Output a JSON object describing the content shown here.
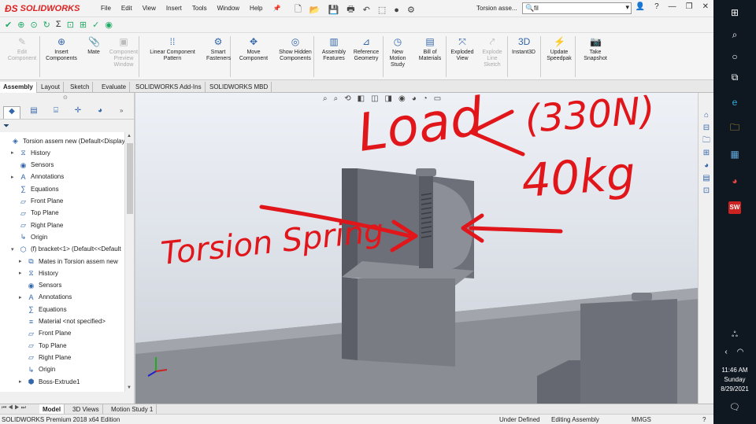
{
  "app": {
    "brand": "SOLIDWORKS",
    "doc_title": "Torsion asse...",
    "search_value": "fil"
  },
  "menu": [
    "File",
    "Edit",
    "View",
    "Insert",
    "Tools",
    "Window",
    "Help"
  ],
  "commands": [
    {
      "label": "Edit Component",
      "disabled": true,
      "icon": "edit-component-icon"
    },
    {
      "label": "Insert Components",
      "disabled": false,
      "icon": "insert-components-icon"
    },
    {
      "label": "Mate",
      "disabled": false,
      "icon": "paperclip-icon"
    },
    {
      "label": "Component Preview Window",
      "disabled": true,
      "icon": "preview-window-icon"
    },
    {
      "label": "Linear Component Pattern",
      "disabled": false,
      "icon": "pattern-icon"
    },
    {
      "label": "Smart Fasteners",
      "disabled": false,
      "icon": "fastener-icon"
    },
    {
      "label": "Move Component",
      "disabled": false,
      "icon": "move-icon"
    },
    {
      "label": "Show Hidden Components",
      "disabled": false,
      "icon": "show-hidden-icon"
    },
    {
      "label": "Assembly Features",
      "disabled": false,
      "icon": "assembly-features-icon"
    },
    {
      "label": "Reference Geometry",
      "disabled": false,
      "icon": "reference-geometry-icon"
    },
    {
      "label": "New Motion Study",
      "disabled": false,
      "icon": "motion-study-icon"
    },
    {
      "label": "Bill of Materials",
      "disabled": false,
      "icon": "bom-icon"
    },
    {
      "label": "Exploded View",
      "disabled": false,
      "icon": "exploded-view-icon"
    },
    {
      "label": "Explode Line Sketch",
      "disabled": true,
      "icon": "explode-line-icon"
    },
    {
      "label": "Instant3D",
      "disabled": false,
      "icon": "instant3d-icon"
    },
    {
      "label": "Update Speedpak",
      "disabled": false,
      "icon": "speedpak-icon"
    },
    {
      "label": "Take Snapshot",
      "disabled": false,
      "icon": "camera-icon"
    }
  ],
  "tabs": [
    "Assembly",
    "Layout",
    "Sketch",
    "Evaluate",
    "SOLIDWORKS Add-Ins",
    "SOLIDWORKS MBD"
  ],
  "tree": [
    {
      "label": "Torsion assem new  (Default<Display",
      "level": 0,
      "expander": "",
      "icon": "assembly-icon"
    },
    {
      "label": "History",
      "level": 1,
      "expander": "▸",
      "icon": "history-icon"
    },
    {
      "label": "Sensors",
      "level": 1,
      "expander": "",
      "icon": "sensor-icon"
    },
    {
      "label": "Annotations",
      "level": 1,
      "expander": "▸",
      "icon": "annotations-icon"
    },
    {
      "label": "Equations",
      "level": 1,
      "expander": "",
      "icon": "equations-icon"
    },
    {
      "label": "Front Plane",
      "level": 1,
      "expander": "",
      "icon": "plane-icon"
    },
    {
      "label": "Top Plane",
      "level": 1,
      "expander": "",
      "icon": "plane-icon"
    },
    {
      "label": "Right Plane",
      "level": 1,
      "expander": "",
      "icon": "plane-icon"
    },
    {
      "label": "Origin",
      "level": 1,
      "expander": "",
      "icon": "origin-icon"
    },
    {
      "label": "(f) bracket<1> (Default<<Default",
      "level": 1,
      "expander": "▾",
      "icon": "part-icon"
    },
    {
      "label": "Mates in Torsion assem new",
      "level": 2,
      "expander": "▸",
      "icon": "mates-icon"
    },
    {
      "label": "History",
      "level": 2,
      "expander": "▸",
      "icon": "history-icon"
    },
    {
      "label": "Sensors",
      "level": 2,
      "expander": "",
      "icon": "sensor-icon"
    },
    {
      "label": "Annotations",
      "level": 2,
      "expander": "▸",
      "icon": "annotations-icon"
    },
    {
      "label": "Equations",
      "level": 2,
      "expander": "",
      "icon": "equations-icon"
    },
    {
      "label": "Material <not specified>",
      "level": 2,
      "expander": "",
      "icon": "material-icon"
    },
    {
      "label": "Front Plane",
      "level": 2,
      "expander": "",
      "icon": "plane-icon"
    },
    {
      "label": "Top Plane",
      "level": 2,
      "expander": "",
      "icon": "plane-icon"
    },
    {
      "label": "Right Plane",
      "level": 2,
      "expander": "",
      "icon": "plane-icon"
    },
    {
      "label": "Origin",
      "level": 2,
      "expander": "",
      "icon": "origin-icon"
    },
    {
      "label": "Boss-Extrude1",
      "level": 2,
      "expander": "▸",
      "icon": "extrude-icon"
    }
  ],
  "bottom_tabs": [
    "Model",
    "3D Views",
    "Motion Study 1"
  ],
  "status": {
    "edition": "SOLIDWORKS Premium 2018 x64 Edition",
    "state": "Under Defined",
    "mode": "Editing Assembly",
    "units": "MMGS"
  },
  "annotations": {
    "load": "Load",
    "force": "(330N)",
    "mass": "40kg",
    "spring": "Torsion Spring"
  },
  "clock": {
    "time": "11:46 AM",
    "day": "Sunday",
    "date": "8/29/2021"
  },
  "colors": {
    "brand": "#dd2222",
    "annotation": "#e0161b",
    "taskbar": "#0f1720"
  }
}
